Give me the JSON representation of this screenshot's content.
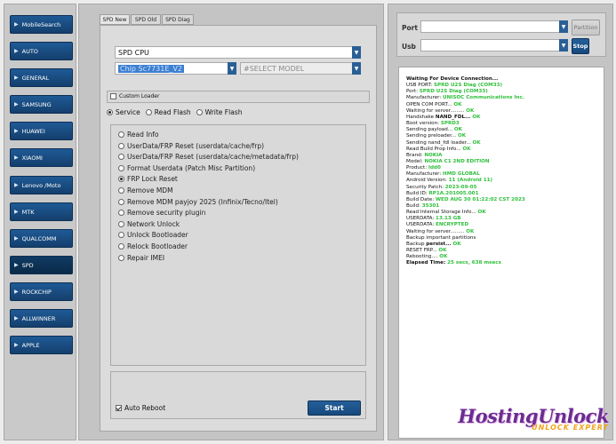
{
  "sidebar": {
    "items": [
      {
        "label": "MobileSearch"
      },
      {
        "label": "AUTO"
      },
      {
        "label": "GENERAL"
      },
      {
        "label": "SAMSUNG"
      },
      {
        "label": "HUAWEI"
      },
      {
        "label": "XIAOMI"
      },
      {
        "label": "Lenovo /Moto"
      },
      {
        "label": "MTK"
      },
      {
        "label": "QUALCOMM"
      },
      {
        "label": "SPD"
      },
      {
        "label": "ROCKCHIP"
      },
      {
        "label": "ALLWINNER"
      },
      {
        "label": "APPLE"
      }
    ],
    "active": "SPD"
  },
  "tabs": [
    "SPD New",
    "SPD Old",
    "SPD Diag"
  ],
  "cpu_select": {
    "value": "SPD CPU"
  },
  "chip_select": {
    "value": "Chip Sc7731E_V2"
  },
  "model_select": {
    "placeholder": "#SELECT MODEL"
  },
  "custom_loader": {
    "label": "Custom Loader"
  },
  "modes": [
    {
      "label": "Service"
    },
    {
      "label": "Read  Flash"
    },
    {
      "label": "Write Flash"
    }
  ],
  "operations": [
    "Read Info",
    "UserData/FRP Reset (userdata/cache/frp)",
    "UserData/FRP Reset (userdata/cache/metadata/frp)",
    "Format Userdata (Patch Misc Partition)",
    "FRP Lock Reset",
    "Remove MDM",
    "Remove MDM payjoy 2025 (Infinix/Tecno/Itel)",
    "Remove security plugin",
    "Network Unlock",
    "Unlock Bootloader",
    "Relock Bootloader",
    "Repair IMEI"
  ],
  "selected_operation": "FRP Lock Reset",
  "auto_reboot": {
    "label": "Auto Reboot",
    "checked": true
  },
  "start_button": {
    "label": "Start"
  },
  "port": {
    "label": "Port",
    "partition_label": "Partition"
  },
  "usb": {
    "label": "Usb",
    "stop_label": "Stop"
  },
  "log": {
    "lines": [
      {
        "t": "Waiting For Device Connection...",
        "v": "",
        "bold": true
      },
      {
        "t": "USB PORT: ",
        "v": "SPRD U2S Diag (COM33)"
      },
      {
        "t": "Port: ",
        "v": "SPRD U2S Diag (COM33)"
      },
      {
        "t": "Manufacturer: ",
        "v": "UNISOC Communications Inc."
      },
      {
        "t": "OPEN COM PORT... ",
        "v": "OK"
      },
      {
        "t": "Waiting for server......... ",
        "v": "OK"
      },
      {
        "t": "Handshake ",
        "v2": "NAND_FDL... ",
        "v": "OK"
      },
      {
        "t": "Boot version: ",
        "v": "SPRD3"
      },
      {
        "t": "Sending payload... ",
        "v": "OK"
      },
      {
        "t": "Sending preloader... ",
        "v": "OK"
      },
      {
        "t": "Sending nand_fdl loader... ",
        "v": "OK"
      },
      {
        "t": "Read Build Prop Info... ",
        "v": "OK"
      },
      {
        "t": "   Brand: ",
        "v": "NOKIA"
      },
      {
        "t": "   Model: ",
        "v": "NOKIA C1 2ND EDITION"
      },
      {
        "t": "   Product: ",
        "v": "Idd0"
      },
      {
        "t": "   Manufacturer: ",
        "v": "HMD GLOBAL"
      },
      {
        "t": "   Android Version: ",
        "v": "11 (Android 11)"
      },
      {
        "t": "   Security Patch: ",
        "v": "2023-09-05"
      },
      {
        "t": "   Build ID: ",
        "v": "RP1A.201005.001"
      },
      {
        "t": "   Build Date: ",
        "v": "WED AUG 30 01:22:02 CST 2023"
      },
      {
        "t": "   Build: ",
        "v": "35301"
      },
      {
        "t": "Read Internal Storage Info... ",
        "v": "OK"
      },
      {
        "t": "USERDATA: ",
        "v": "13.13 GB"
      },
      {
        "t": "USERDATA: ",
        "v": "ENCRYPTED"
      },
      {
        "t": "Waiting for server......... ",
        "v": "OK"
      },
      {
        "t": "Backup important partitions",
        "v": ""
      },
      {
        "t": "   Backup ",
        "v2": "persist... ",
        "v": "OK"
      },
      {
        "t": "RESET FRP... ",
        "v": "OK"
      },
      {
        "t": "Rebooting.... ",
        "v": "OK"
      },
      {
        "t": "Elapsed Time: ",
        "v": "25 secs, 638 msecs",
        "bold": true
      }
    ]
  },
  "watermark": {
    "line1": "HostingUnlock",
    "line2": "UNLOCK EXPERT"
  }
}
